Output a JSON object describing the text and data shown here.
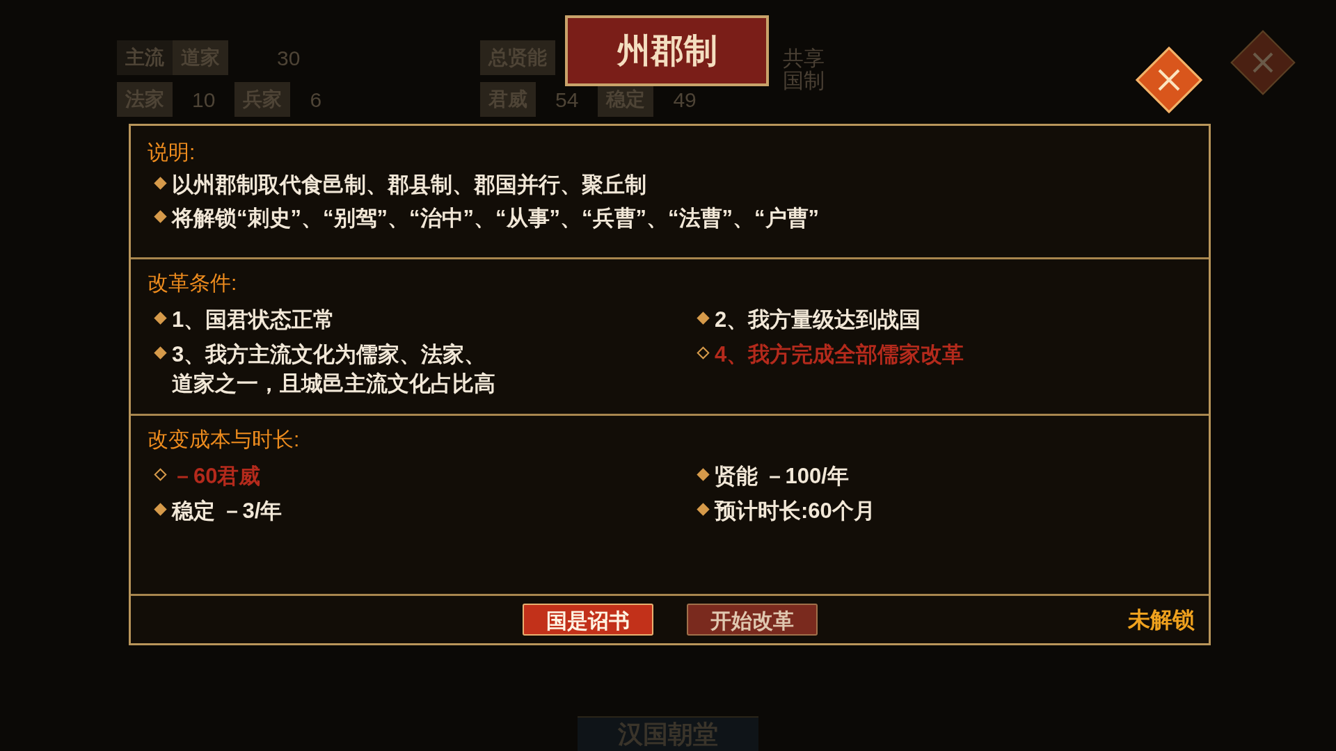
{
  "background": {
    "culture": {
      "mainstream_label": "主流",
      "mainstream_value": "道家",
      "mainstream_count": "30",
      "others": [
        {
          "label": "法家",
          "value": "10"
        },
        {
          "label": "兵家",
          "value": "6"
        }
      ]
    },
    "stats": {
      "talent_label": "总贤能",
      "pairs": [
        {
          "label": "君威",
          "value": "54"
        },
        {
          "label": "稳定",
          "value": "49"
        }
      ]
    },
    "shared_system": "共享国制",
    "court_title": "汉国朝堂"
  },
  "dialog": {
    "title": "州郡制",
    "description": {
      "label": "说明:",
      "lines": [
        "以州郡制取代食邑制、郡县制、郡国并行、聚丘制",
        "将解锁“刺史”、“别驾”、“治中”、“从事”、“兵曹”、“法曹”、“户曹”"
      ]
    },
    "conditions": {
      "label": "改革条件:",
      "items": [
        {
          "text": "1、国君状态正常",
          "met": true
        },
        {
          "text": "2、我方量级达到战国",
          "met": true
        },
        {
          "text": "3、我方主流文化为儒家、法家、道家之一，且城邑主流文化占比高",
          "met": true
        },
        {
          "text": "4、我方完成全部儒家改革",
          "met": false
        }
      ]
    },
    "costs": {
      "label": "改变成本与时长:",
      "items": [
        {
          "text": "－60君威",
          "met": false
        },
        {
          "text": "贤能 －100/年",
          "met": true
        },
        {
          "text": "稳定 －3/年",
          "met": true
        },
        {
          "text": "预计时长:60个月",
          "met": true
        }
      ]
    },
    "buttons": [
      {
        "label": "国是诏书",
        "disabled": false
      },
      {
        "label": "开始改革",
        "disabled": true
      }
    ],
    "status": "未解锁"
  }
}
